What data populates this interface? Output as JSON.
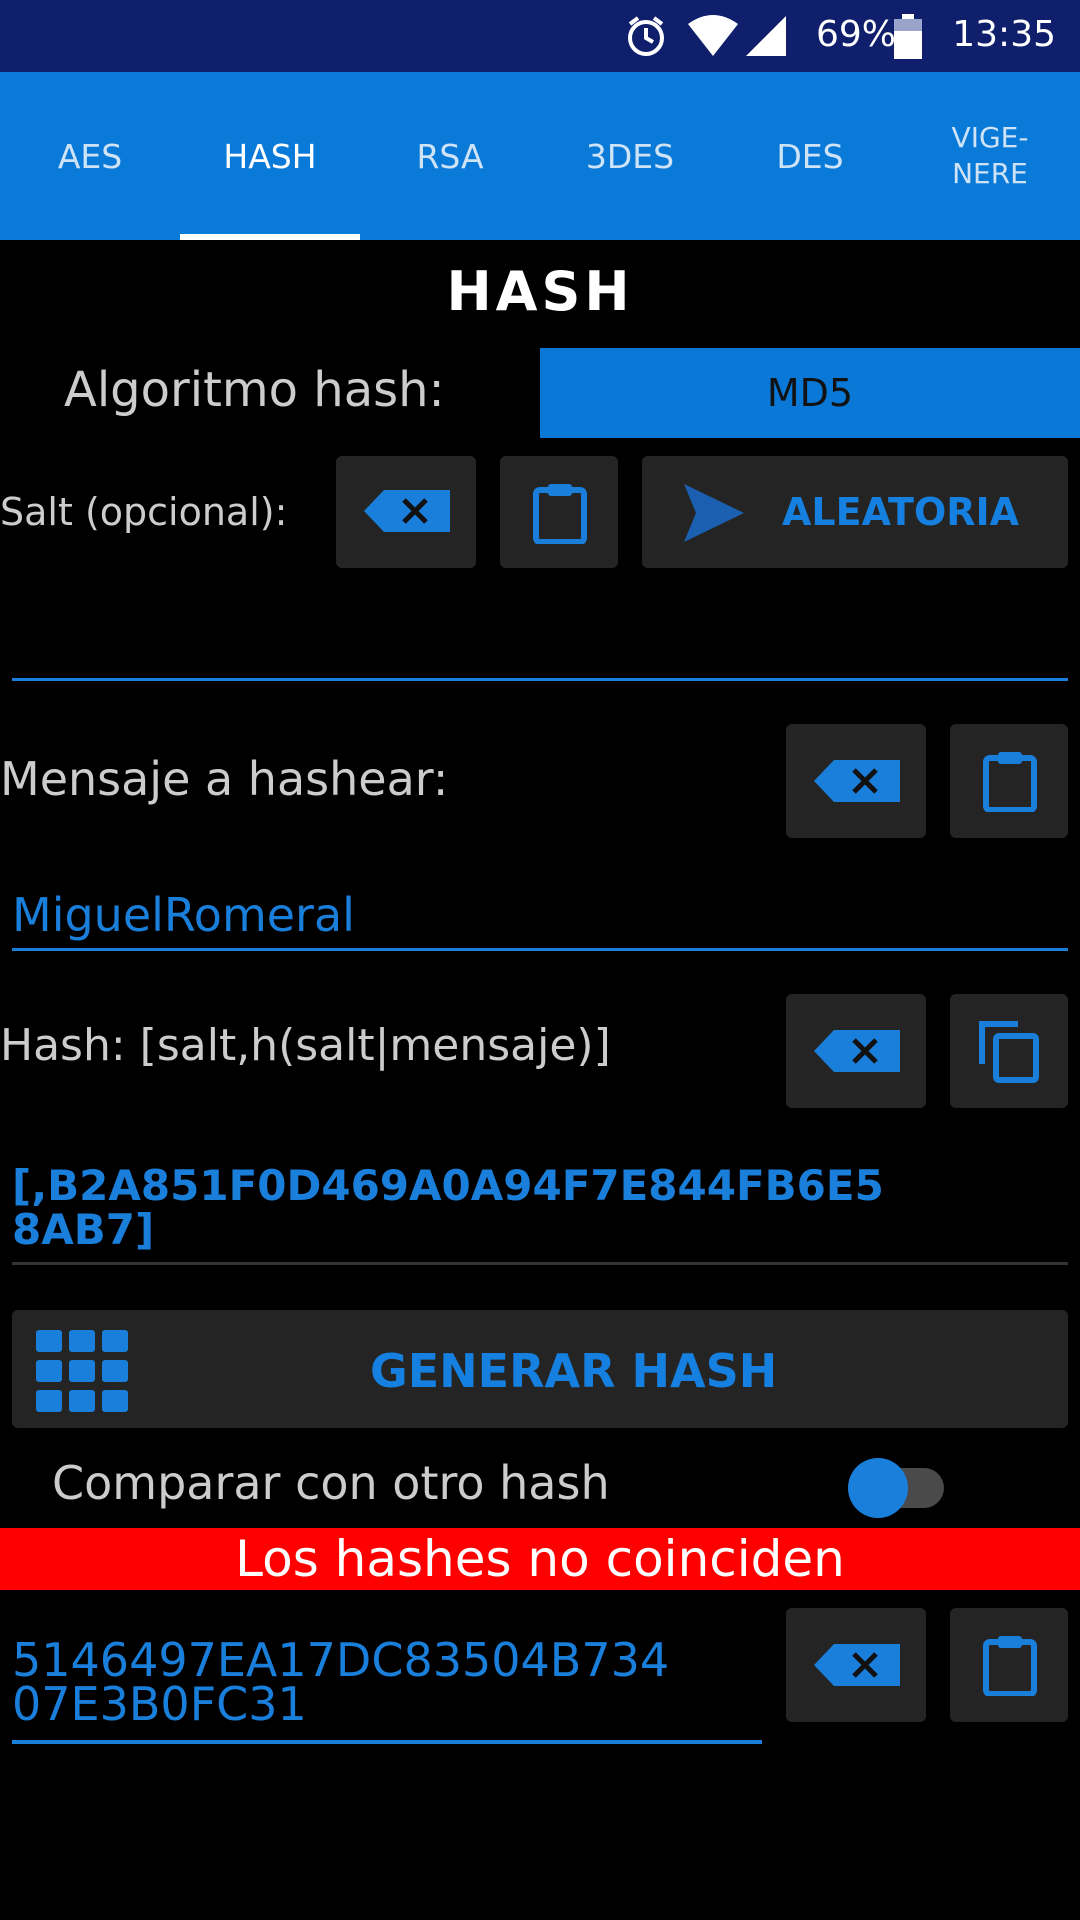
{
  "status": {
    "battery": "69%",
    "time": "13:35"
  },
  "tabs": [
    {
      "label": "AES"
    },
    {
      "label": "HASH"
    },
    {
      "label": "RSA"
    },
    {
      "label": "3DES"
    },
    {
      "label": "DES"
    },
    {
      "label": "VIGE-\nNERE"
    }
  ],
  "page": {
    "title": "HASH"
  },
  "algorithm": {
    "label": "Algoritmo hash:",
    "value": "MD5"
  },
  "salt": {
    "label": "Salt (opcional):",
    "random_label": "ALEATORIA",
    "value": ""
  },
  "message": {
    "label": "Mensaje a hashear:",
    "value": "MiguelRomeral"
  },
  "hash": {
    "label": "Hash: [salt,h(salt|mensaje)]",
    "value": "[,B2A851F0D469A0A94F7E844FB6E5\n8AB7]"
  },
  "generate": {
    "label": "GENERAR HASH"
  },
  "compare": {
    "label": "Comparar con otro hash",
    "enabled": true,
    "result": "Los hashes no coinciden",
    "value": "5146497EA17DC83504B734\n07E3B0FC31"
  },
  "colors": {
    "accent": "#1a7fdb",
    "tabbar": "#0a7ad9",
    "statusbar": "#0f1f6b",
    "error": "#ff0000"
  }
}
